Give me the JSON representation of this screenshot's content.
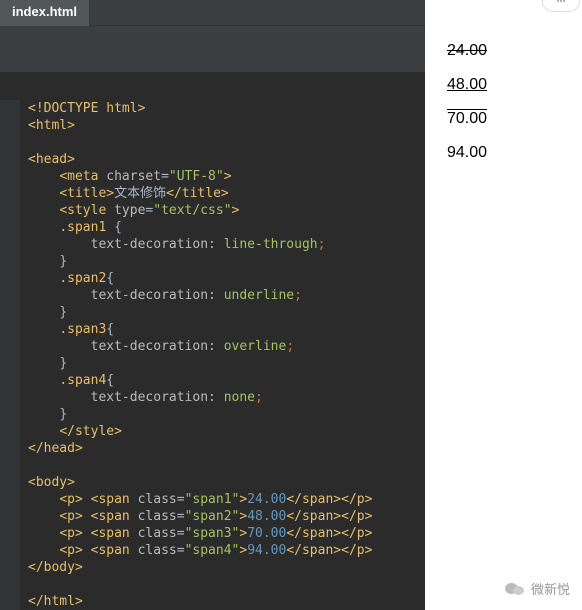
{
  "tab": {
    "filename": "index.html"
  },
  "code": {
    "doctype": "<!DOCTYPE html>",
    "html_open": "html",
    "head_open": "head",
    "meta_tag": "meta",
    "meta_attr": "charset",
    "meta_val": "\"UTF-8\"",
    "title_tag": "title",
    "title_text": "文本修饰",
    "style_tag": "style",
    "style_attr": "type",
    "style_val": "\"text/css\"",
    "sel1": ".span1",
    "sel2": ".span2",
    "sel3": ".span3",
    "sel4": ".span4",
    "prop": "text-decoration",
    "val1": "line-through",
    "val2": "underline",
    "val3": "overline",
    "val4": "none",
    "body_tag": "body",
    "p_tag": "p",
    "span_tag": "span",
    "class_attr": "class",
    "cls1": "\"span1\"",
    "cls2": "\"span2\"",
    "cls3": "\"span3\"",
    "cls4": "\"span4\"",
    "num1": "24.00",
    "num2": "48.00",
    "num3": "70.00",
    "num4": "94.00"
  },
  "preview": {
    "v1": "24.00",
    "v2": "48.00",
    "v3": "70.00",
    "v4": "94.00"
  },
  "watermark": {
    "text": "微新悦"
  }
}
